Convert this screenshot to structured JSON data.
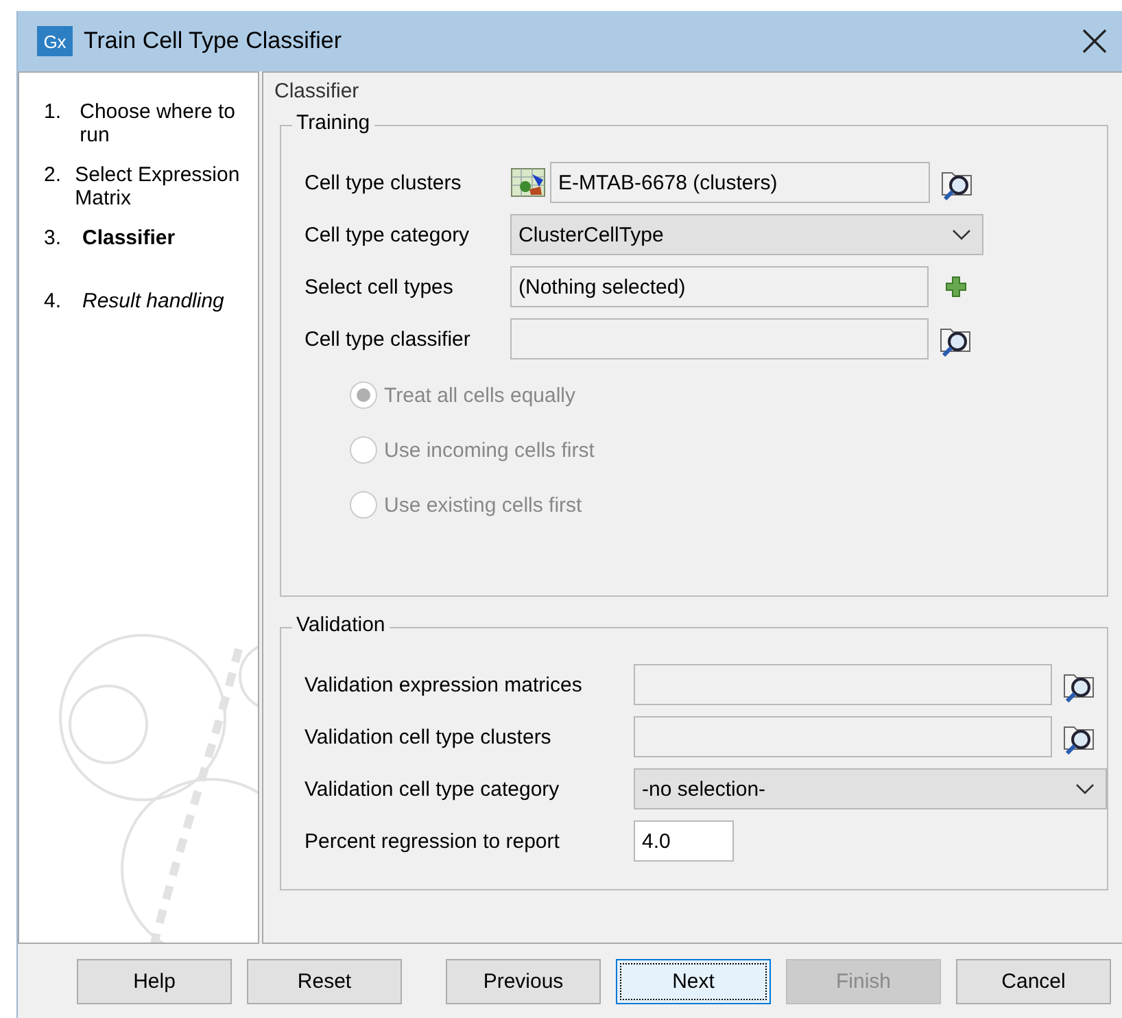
{
  "window": {
    "title": "Train Cell Type Classifier",
    "app_badge": "Gx"
  },
  "steps": [
    {
      "number": "1.",
      "label": "Choose where to run",
      "selected": false,
      "pending": false
    },
    {
      "number": "2.",
      "label": "Select Expression Matrix",
      "selected": false,
      "pending": false
    },
    {
      "number": "3.",
      "label": "Classifier",
      "selected": true,
      "pending": false
    },
    {
      "number": "4.",
      "label": "Result handling",
      "selected": false,
      "pending": true
    }
  ],
  "page_title": "Classifier",
  "groups": [
    {
      "title": "Training",
      "fields": [
        {
          "kind": "typed_file",
          "label": "Cell type clusters",
          "value": "E-MTAB-6678 (clusters)"
        },
        {
          "kind": "dropdown",
          "label": "Cell type category",
          "value": "ClusterCellType"
        },
        {
          "kind": "picker",
          "label": "Select cell types",
          "value": "(Nothing selected)"
        },
        {
          "kind": "file",
          "label": "Cell type classifier"
        }
      ],
      "radios": [
        {
          "label": "Treat all cells equally",
          "selected": true,
          "disabled": true
        },
        {
          "label": "Use incoming cells first",
          "selected": false,
          "disabled": true
        },
        {
          "label": "Use existing cells first",
          "selected": false,
          "disabled": true
        }
      ]
    },
    {
      "title": "Validation",
      "fields": [
        {
          "kind": "file",
          "label": "Validation expression matrices"
        },
        {
          "kind": "file",
          "label": "Validation cell type clusters"
        },
        {
          "kind": "dropdown",
          "label": "Validation cell type category",
          "value": "-no selection-"
        },
        {
          "kind": "number",
          "label": "Percent regression to report",
          "value": "4.0"
        }
      ]
    }
  ],
  "buttons": [
    {
      "label": "Help",
      "disabled": false,
      "focused": false
    },
    {
      "label": "Reset",
      "disabled": false,
      "focused": false
    },
    {
      "label": "Previous",
      "disabled": false,
      "focused": false
    },
    {
      "label": "Next",
      "disabled": false,
      "focused": true
    },
    {
      "label": "Finish",
      "disabled": true,
      "focused": false
    },
    {
      "label": "Cancel",
      "disabled": false,
      "focused": false
    }
  ]
}
